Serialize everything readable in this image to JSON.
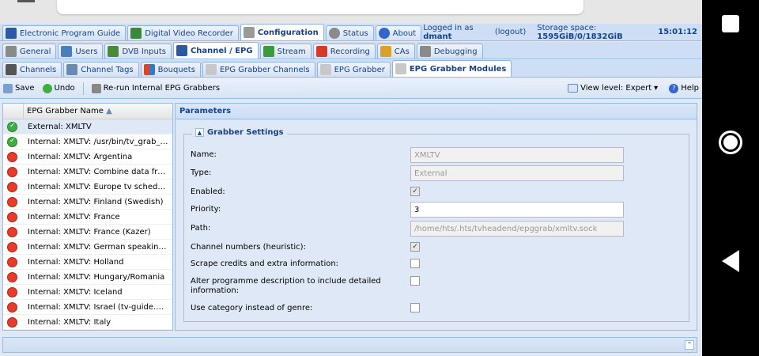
{
  "top_tabs": [
    {
      "label": "Electronic Program Guide",
      "icon": "epg-icon",
      "color": "#2a5aa8"
    },
    {
      "label": "Digital Video Recorder",
      "icon": "dvr-icon",
      "color": "#3b8a3b"
    },
    {
      "label": "Configuration",
      "icon": "wrench-icon",
      "color": "#888888"
    },
    {
      "label": "Status",
      "icon": "eye-icon",
      "color": "#7f7f7f"
    },
    {
      "label": "About",
      "icon": "info-icon",
      "color": "#3366cc"
    }
  ],
  "status": {
    "logged_in_prefix": "Logged in as",
    "user": "dmant",
    "logout": "(logout)",
    "storage_prefix": "Storage space:",
    "storage": "1595GiB/0/1832GiB",
    "time": "15:01:12"
  },
  "config_tabs": [
    {
      "label": "General",
      "icon": "tools-icon",
      "color": "#777777"
    },
    {
      "label": "Users",
      "icon": "users-icon",
      "color": "#4a7fbf"
    },
    {
      "label": "DVB Inputs",
      "icon": "dvb-card-icon",
      "color": "#4a8a3a"
    },
    {
      "label": "Channel / EPG",
      "icon": "tv-icon",
      "color": "#2b5aa0"
    },
    {
      "label": "Stream",
      "icon": "stream-icon",
      "color": "#3b9a3b"
    },
    {
      "label": "Recording",
      "icon": "rec-icon",
      "color": "#d83a2a"
    },
    {
      "label": "CAs",
      "icon": "key-icon",
      "color": "#d8a12a"
    },
    {
      "label": "Debugging",
      "icon": "bug-icon",
      "color": "#8a8a8a"
    }
  ],
  "epg_tabs": [
    {
      "label": "Channels",
      "icon": "phone-icon",
      "color": "#555555"
    },
    {
      "label": "Channel Tags",
      "icon": "tags-icon",
      "color": "#6a8ab0"
    },
    {
      "label": "Bouquets",
      "icon": "bouquet-icon",
      "color": "#d8472a"
    },
    {
      "label": "EPG Grabber Channels",
      "icon": "grabber-channels-icon",
      "color": "#c0c0c0"
    },
    {
      "label": "EPG Grabber",
      "icon": "grabber-icon",
      "color": "#c0c0c0"
    },
    {
      "label": "EPG Grabber Modules",
      "icon": "grabber-modules-icon",
      "color": "#c0c0c0"
    }
  ],
  "toolbar": {
    "save": "Save",
    "undo": "Undo",
    "rerun": "Re-run Internal EPG Grabbers",
    "view_level": "View level: Expert",
    "help": "Help"
  },
  "grid": {
    "column": "EPG Grabber Name",
    "rows": [
      {
        "name": "External: XMLTV",
        "status": "ok"
      },
      {
        "name": "Internal: XMLTV: /usr/bin/tv_grab_wg++",
        "status": "ok"
      },
      {
        "name": "Internal: XMLTV: Argentina",
        "status": "bad"
      },
      {
        "name": "Internal: XMLTV: Combine data from several sources",
        "status": "bad"
      },
      {
        "name": "Internal: XMLTV: Europe tv schedules for free",
        "status": "bad"
      },
      {
        "name": "Internal: XMLTV: Finland (Swedish)",
        "status": "bad"
      },
      {
        "name": "Internal: XMLTV: France",
        "status": "bad"
      },
      {
        "name": "Internal: XMLTV: France (Kazer)",
        "status": "bad"
      },
      {
        "name": "Internal: XMLTV: German speaking area",
        "status": "bad"
      },
      {
        "name": "Internal: XMLTV: Holland",
        "status": "bad"
      },
      {
        "name": "Internal: XMLTV: Hungary/Romania",
        "status": "bad"
      },
      {
        "name": "Internal: XMLTV: Iceland",
        "status": "bad"
      },
      {
        "name": "Internal: XMLTV: Israel (tv-guide.walla.co.il)",
        "status": "bad"
      },
      {
        "name": "Internal: XMLTV: Italy",
        "status": "bad"
      }
    ]
  },
  "params": {
    "title": "Parameters",
    "section": "Grabber Settings",
    "fields": {
      "name_label": "Name:",
      "name_value": "XMLTV",
      "type_label": "Type:",
      "type_value": "External",
      "enabled_label": "Enabled:",
      "priority_label": "Priority:",
      "priority_value": "3",
      "path_label": "Path:",
      "path_value": "/home/hts/.hts/tvheadend/epggrab/xmltv.sock",
      "chnum_label": "Channel numbers (heuristic):",
      "scrape_label": "Scrape credits and extra information:",
      "alter_label": "Alter programme description to include detailed information:",
      "category_label": "Use category instead of genre:"
    }
  }
}
